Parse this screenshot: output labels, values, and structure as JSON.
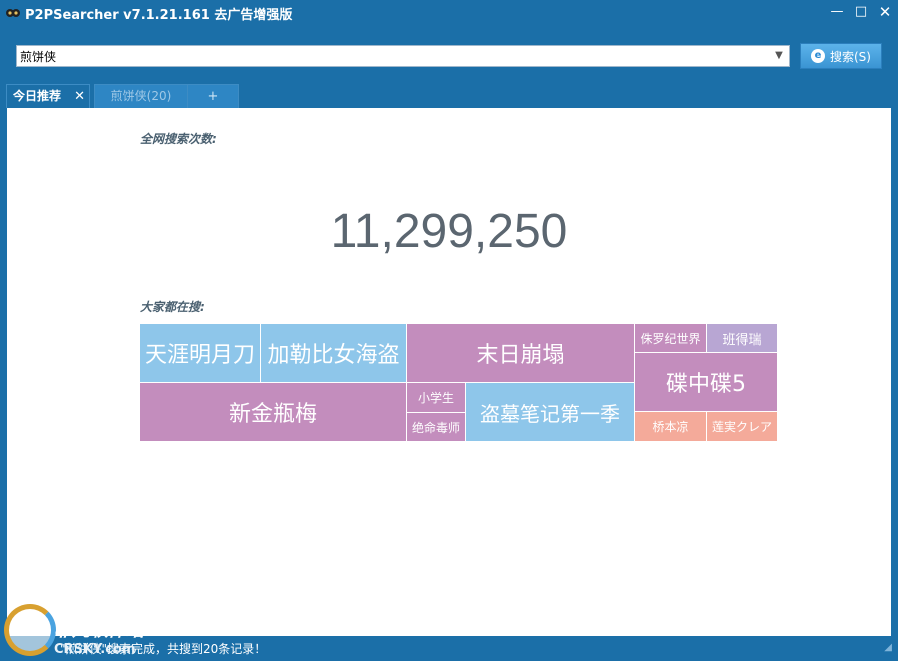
{
  "window": {
    "title": "P2PSearcher v7.1.21.161 去广告增强版",
    "min_glyph": "—",
    "max_glyph": "□",
    "close_glyph": "✕"
  },
  "search": {
    "value": "煎饼侠",
    "button_label": "搜索(S)",
    "button_icon_glyph": "e"
  },
  "tabs": [
    {
      "label": "今日推荐",
      "active": true,
      "close_glyph": "✕"
    },
    {
      "label": "煎饼侠(20)",
      "active": false
    },
    {
      "label": "+",
      "active": false
    }
  ],
  "main": {
    "total_label": "全网搜索次数:",
    "total_count": "11,299,250",
    "hot_label": "大家都在搜:"
  },
  "hot_searches": [
    {
      "text": "天涯明月刀",
      "color": "#8ec6ea"
    },
    {
      "text": "加勒比女海盗",
      "color": "#8ec6ea"
    },
    {
      "text": "末日崩塌",
      "color": "#c38dbd"
    },
    {
      "text": "侏罗纪世界",
      "color": "#c38dbd"
    },
    {
      "text": "班得瑞",
      "color": "#b8a6d3"
    },
    {
      "text": "碟中碟5",
      "color": "#c38dbd"
    },
    {
      "text": "新金瓶梅",
      "color": "#c38dbd"
    },
    {
      "text": "小学生",
      "color": "#c38dbd"
    },
    {
      "text": "绝命毒师",
      "color": "#c38dbd"
    },
    {
      "text": "盗墓笔记第一季",
      "color": "#8ec6ea"
    },
    {
      "text": "桥本凉",
      "color": "#f4aa9a"
    },
    {
      "text": "莲実クレア",
      "color": "#f4aa9a"
    }
  ],
  "status": {
    "text": "\"煎饼侠\"搜索完成，共搜到20条记录！",
    "grip_glyph": "◢"
  },
  "watermark": {
    "text": "非凡软件站",
    "sub": "CRSKY.com"
  }
}
